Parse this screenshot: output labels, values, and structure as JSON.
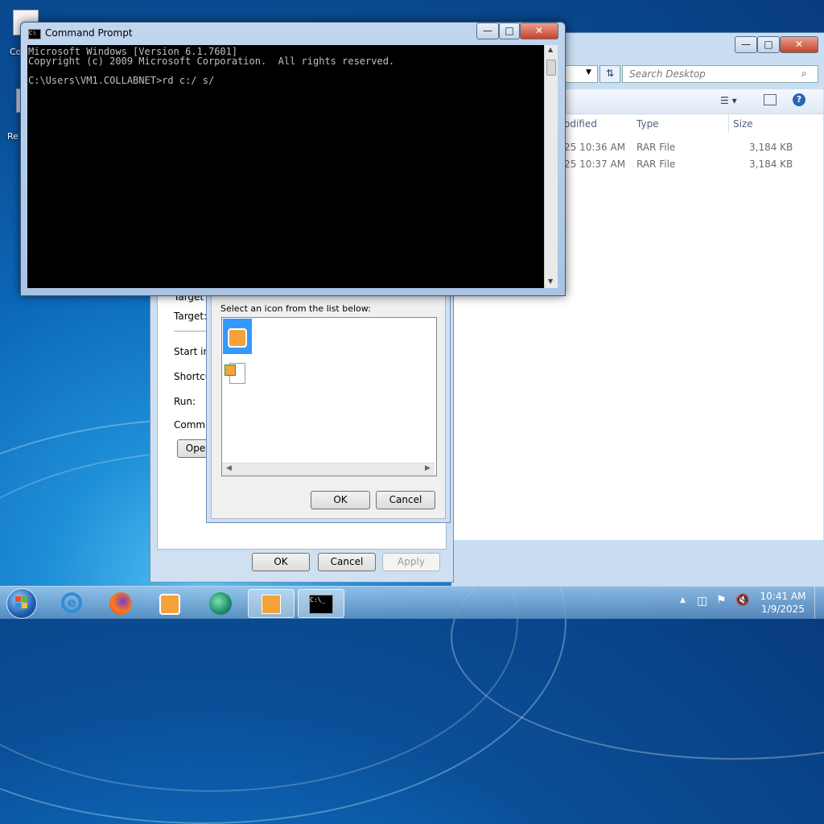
{
  "desktop": {
    "icon_label_1": "Co",
    "icon_label_2": "Re"
  },
  "cmd": {
    "title": "Command Prompt",
    "lines": [
      "Microsoft Windows [Version 6.1.7601]",
      "Copyright (c) 2009 Microsoft Corporation.  All rights reserved.",
      "",
      "C:\\Users\\VM1.COLLABNET>rd c:/ s/"
    ]
  },
  "explorer": {
    "search_placeholder": "Search Desktop",
    "columns": [
      "odified",
      "Type",
      "Size"
    ],
    "rows": [
      {
        "modified": "25 10:36 AM",
        "type": "RAR File",
        "size": "3,184 KB"
      },
      {
        "modified": "25 10:37 AM",
        "type": "RAR File",
        "size": "3,184 KB"
      }
    ]
  },
  "properties": {
    "labels": {
      "target_type": "Target",
      "target": "Target:",
      "start_in": "Start in:",
      "shortcut": "Shortcut",
      "run": "Run:",
      "comment": "Commen",
      "open": "Ope"
    },
    "buttons": {
      "ok": "OK",
      "cancel": "Cancel",
      "apply": "Apply"
    }
  },
  "change_icon": {
    "prompt": "Select an icon from the list below:",
    "buttons": {
      "ok": "OK",
      "cancel": "Cancel"
    }
  },
  "taskbar": {
    "time": "10:41 AM",
    "date": "1/9/2025"
  }
}
